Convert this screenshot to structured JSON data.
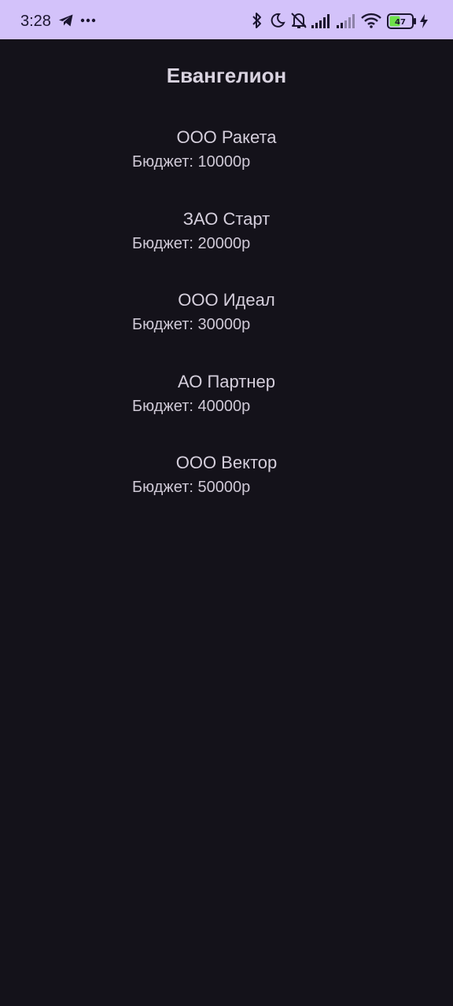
{
  "status_bar": {
    "time": "3:28",
    "battery_level": "47",
    "icons": [
      "telegram-icon",
      "more-dots-icon",
      "bluetooth-icon",
      "moon-icon",
      "bell-off-icon",
      "signal-icon",
      "signal-icon",
      "wifi-icon",
      "battery-icon",
      "charging-icon"
    ],
    "background_color": "#d3c2fa",
    "battery_fill_color": "#6ee14a"
  },
  "page": {
    "title": "Евангелион",
    "background_color": "#14121a"
  },
  "companies": [
    {
      "name": "ООО Ракета",
      "budget": "Бюджет: 10000р"
    },
    {
      "name": "ЗАО Старт",
      "budget": "Бюджет: 20000р"
    },
    {
      "name": "ООО Идеал",
      "budget": "Бюджет: 30000р"
    },
    {
      "name": "АО Партнер",
      "budget": "Бюджет: 40000р"
    },
    {
      "name": "ООО Вектор",
      "budget": "Бюджет: 50000р"
    }
  ]
}
